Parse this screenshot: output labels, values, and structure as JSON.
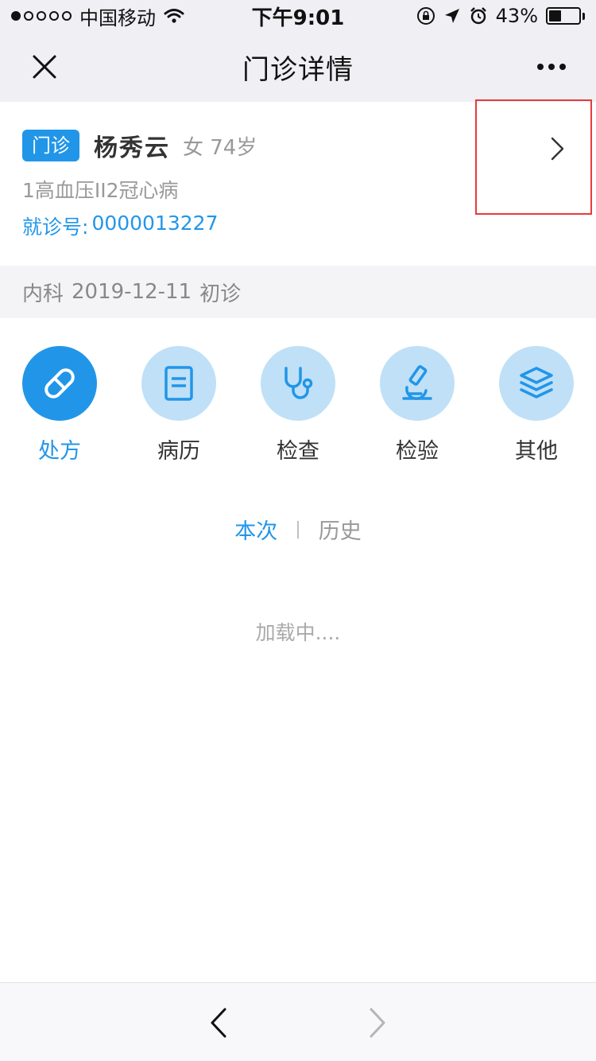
{
  "status_bar": {
    "carrier": "中国移动",
    "time": "下午9:01",
    "battery_text": "43%",
    "battery_level": 0.43
  },
  "nav": {
    "title": "门诊详情",
    "close_icon": "close-icon",
    "more_icon": "more-icon"
  },
  "patient": {
    "visit_type": "门诊",
    "name": "杨秀云",
    "gender_age": "女 74岁",
    "diagnosis": "1高血压II2冠心病",
    "visit_no_label": "就诊号:",
    "visit_no_value": "0000013227"
  },
  "visit_info": {
    "dept": "内科",
    "date": "2019-12-11",
    "visit_kind": "初诊"
  },
  "categories": [
    {
      "label": "处方",
      "icon": "pill-icon",
      "active": true
    },
    {
      "label": "病历",
      "icon": "document-icon",
      "active": false
    },
    {
      "label": "检查",
      "icon": "stethoscope-icon",
      "active": false
    },
    {
      "label": "检验",
      "icon": "microscope-icon",
      "active": false
    },
    {
      "label": "其他",
      "icon": "layers-icon",
      "active": false
    }
  ],
  "tabs": {
    "current": "本次",
    "separator": "|",
    "history": "历史"
  },
  "loading_text": "加载中....",
  "colors": {
    "accent": "#2196e8",
    "icon_bg": "#bfe0f7",
    "highlight": "#e83a3a"
  }
}
